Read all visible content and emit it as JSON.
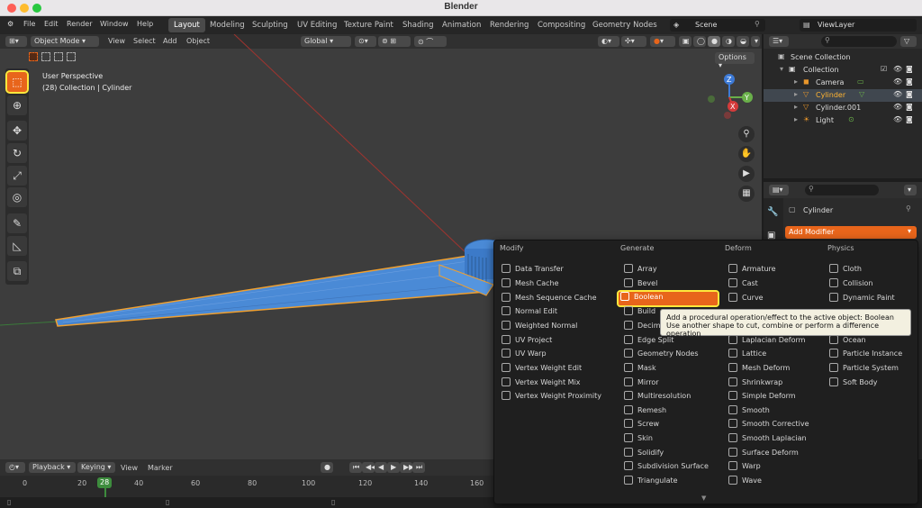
{
  "window": {
    "title": "Blender"
  },
  "menubar": {
    "items": [
      "File",
      "Edit",
      "Render",
      "Window",
      "Help"
    ]
  },
  "workspaces": [
    "Layout",
    "Modeling",
    "Sculpting",
    "UV Editing",
    "Texture Paint",
    "Shading",
    "Animation",
    "Rendering",
    "Compositing",
    "Geometry Nodes"
  ],
  "scene": {
    "name": "Scene",
    "view_layer": "ViewLayer"
  },
  "viewport": {
    "mode": "Object Mode",
    "menus": [
      "View",
      "Select",
      "Add",
      "Object"
    ],
    "transform": "Global",
    "options": "Options",
    "overlay_line1": "User Perspective",
    "overlay_line2": "(28) Collection | Cylinder",
    "gizmo": {
      "z": "Z",
      "y": "Y",
      "x": "X"
    }
  },
  "outliner": {
    "root": "Scene Collection",
    "collection": "Collection",
    "objects": [
      "Camera",
      "Cylinder",
      "Cylinder.001",
      "Light"
    ],
    "selected": "Cylinder"
  },
  "properties": {
    "object_name": "Cylinder",
    "add_modifier": "Add Modifier"
  },
  "timeline": {
    "playback": "Playback",
    "keying": "Keying",
    "view": "View",
    "marker": "Marker",
    "current_frame": "28",
    "ticks": [
      "0",
      "20",
      "40",
      "60",
      "80",
      "100",
      "120",
      "140",
      "160"
    ]
  },
  "modifier_menu": {
    "columns": [
      {
        "header": "Modify",
        "items": [
          "Data Transfer",
          "Mesh Cache",
          "Mesh Sequence Cache",
          "Normal Edit",
          "Weighted Normal",
          "UV Project",
          "UV Warp",
          "Vertex Weight Edit",
          "Vertex Weight Mix",
          "Vertex Weight Proximity"
        ]
      },
      {
        "header": "Generate",
        "items": [
          "Array",
          "Bevel",
          "Boolean",
          "Build",
          "Decim",
          "Edge Split",
          "Geometry Nodes",
          "Mask",
          "Mirror",
          "Multiresolution",
          "Remesh",
          "Screw",
          "Skin",
          "Solidify",
          "Subdivision Surface",
          "Triangulate"
        ]
      },
      {
        "header": "Deform",
        "items": [
          "Armature",
          "Cast",
          "Curve",
          "",
          "",
          "Laplacian Deform",
          "Lattice",
          "Mesh Deform",
          "Shrinkwrap",
          "Simple Deform",
          "Smooth",
          "Smooth Corrective",
          "Smooth Laplacian",
          "Surface Deform",
          "Warp",
          "Wave"
        ]
      },
      {
        "header": "Physics",
        "items": [
          "Cloth",
          "Collision",
          "Dynamic Paint",
          "",
          "",
          "Ocean",
          "Particle Instance",
          "Particle System",
          "Soft Body"
        ]
      }
    ],
    "highlighted": "Boolean",
    "tooltip_line1": "Add a procedural operation/effect to the active object:  Boolean",
    "tooltip_line2": "Use another shape to cut, combine or perform a difference operation"
  },
  "colors": {
    "accent": "#e8651b",
    "highlight_outline": "#ffe83d",
    "mesh": "#4a8ad6",
    "selected_text": "#ffb432"
  }
}
